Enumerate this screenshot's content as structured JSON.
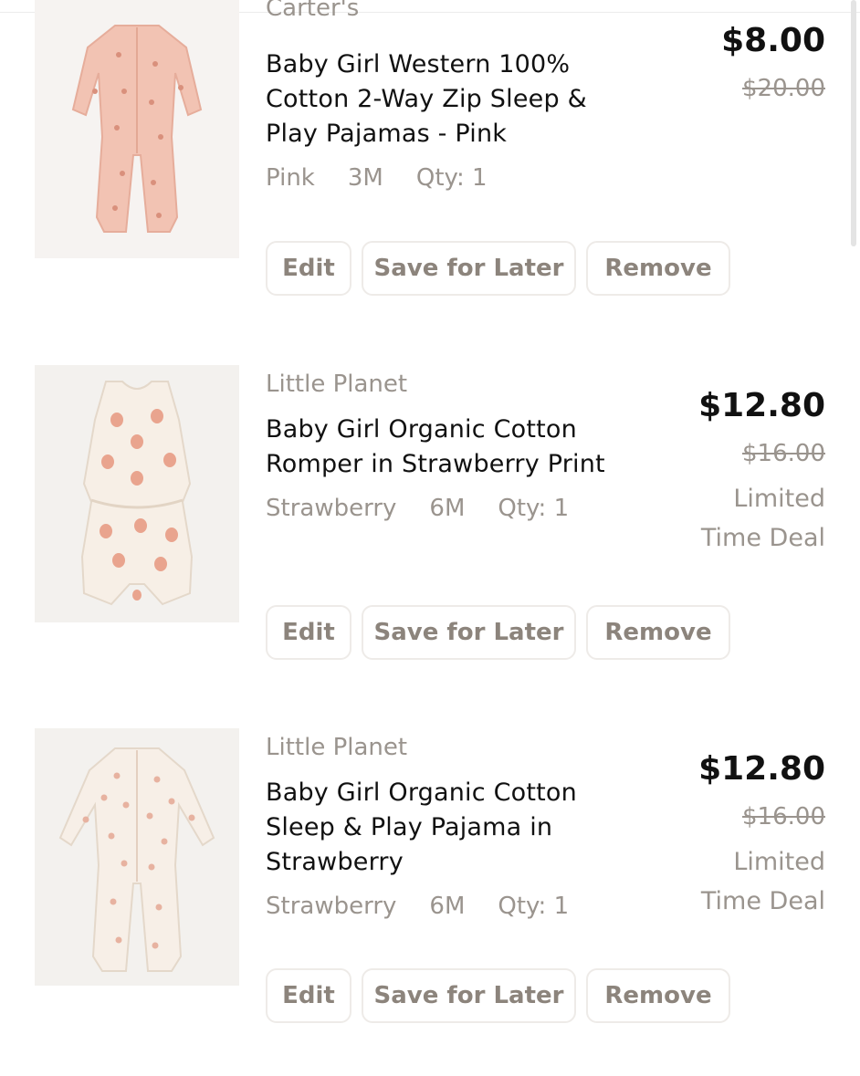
{
  "colors": {
    "muted_text": "#9a948e",
    "button_text": "#8c847c",
    "button_border": "#eeebe8",
    "price": "#111111"
  },
  "cart": {
    "items": [
      {
        "brand": "Carter's",
        "title": "Baby Girl Western 100% Cotton 2-Way Zip Sleep & Play Pajamas - Pink",
        "color": "Pink",
        "size": "3M",
        "qty": "Qty: 1",
        "price": "$8.00",
        "original_price": "$20.00",
        "deal_label": "",
        "image_icon": "pink-sleeper-image",
        "actions": {
          "edit": "Edit",
          "save_for_later": "Save for Later",
          "remove": "Remove"
        }
      },
      {
        "brand": "Little Planet",
        "title": "Baby Girl Organic Cotton Romper in Strawberry Print",
        "color": "Strawberry",
        "size": "6M",
        "qty": "Qty: 1",
        "price": "$12.80",
        "original_price": "$16.00",
        "deal_label": "Limited Time Deal",
        "image_icon": "strawberry-romper-image",
        "actions": {
          "edit": "Edit",
          "save_for_later": "Save for Later",
          "remove": "Remove"
        }
      },
      {
        "brand": "Little Planet",
        "title": "Baby Girl Organic Cotton Sleep & Play Pajama in Strawberry",
        "color": "Strawberry",
        "size": "6M",
        "qty": "Qty: 1",
        "price": "$12.80",
        "original_price": "$16.00",
        "deal_label": "Limited Time Deal",
        "image_icon": "strawberry-sleeper-image",
        "actions": {
          "edit": "Edit",
          "save_for_later": "Save for Later",
          "remove": "Remove"
        }
      }
    ]
  }
}
